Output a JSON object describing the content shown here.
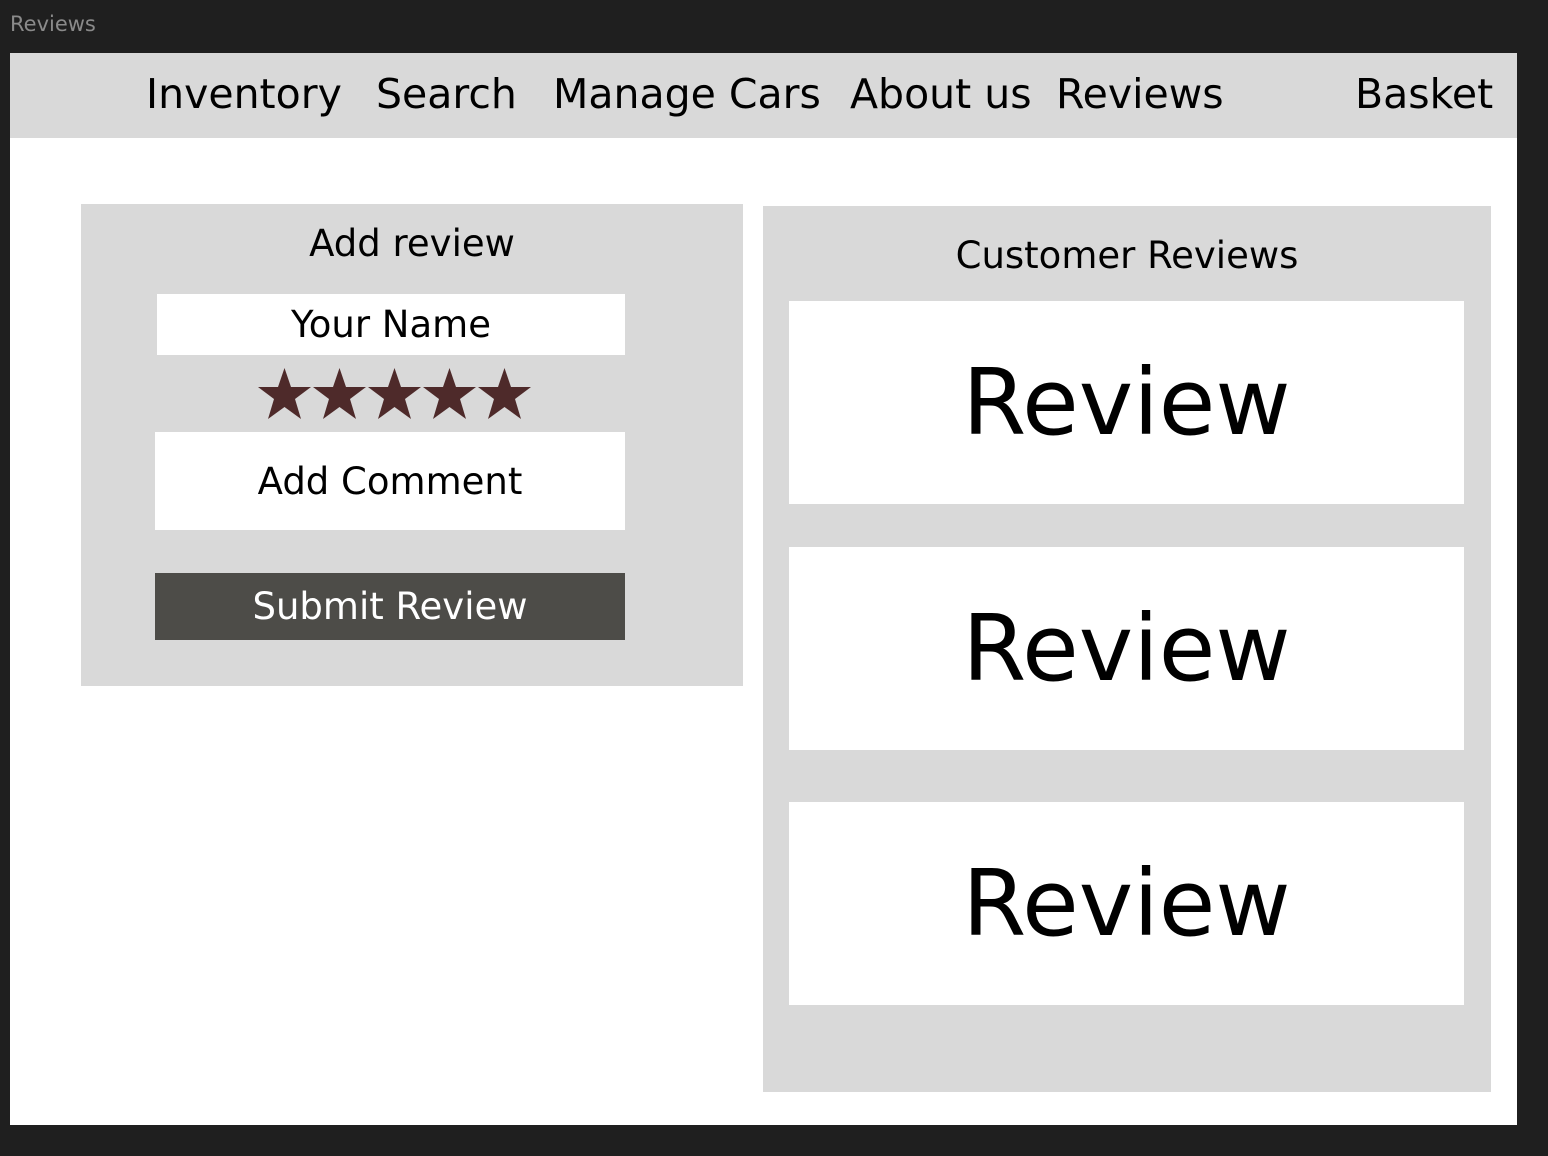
{
  "window": {
    "title": "Reviews"
  },
  "nav": {
    "items": [
      {
        "label": "Inventory"
      },
      {
        "label": "Search"
      },
      {
        "label": "Manage Cars"
      },
      {
        "label": "About us"
      },
      {
        "label": "Reviews"
      },
      {
        "label": "Basket"
      }
    ]
  },
  "add_review": {
    "title": "Add review",
    "name_placeholder": "Your Name",
    "rating": {
      "value": 5,
      "max": 5,
      "color": "#4e2a2a"
    },
    "comment_placeholder": "Add Comment",
    "submit_label": "Submit Review"
  },
  "customer_reviews": {
    "title": "Customer Reviews",
    "items": [
      {
        "text": "Review"
      },
      {
        "text": "Review"
      },
      {
        "text": "Review"
      }
    ]
  },
  "colors": {
    "panel": "#d9d9d9",
    "button": "#4d4c48",
    "background": "#1f1f1f"
  }
}
